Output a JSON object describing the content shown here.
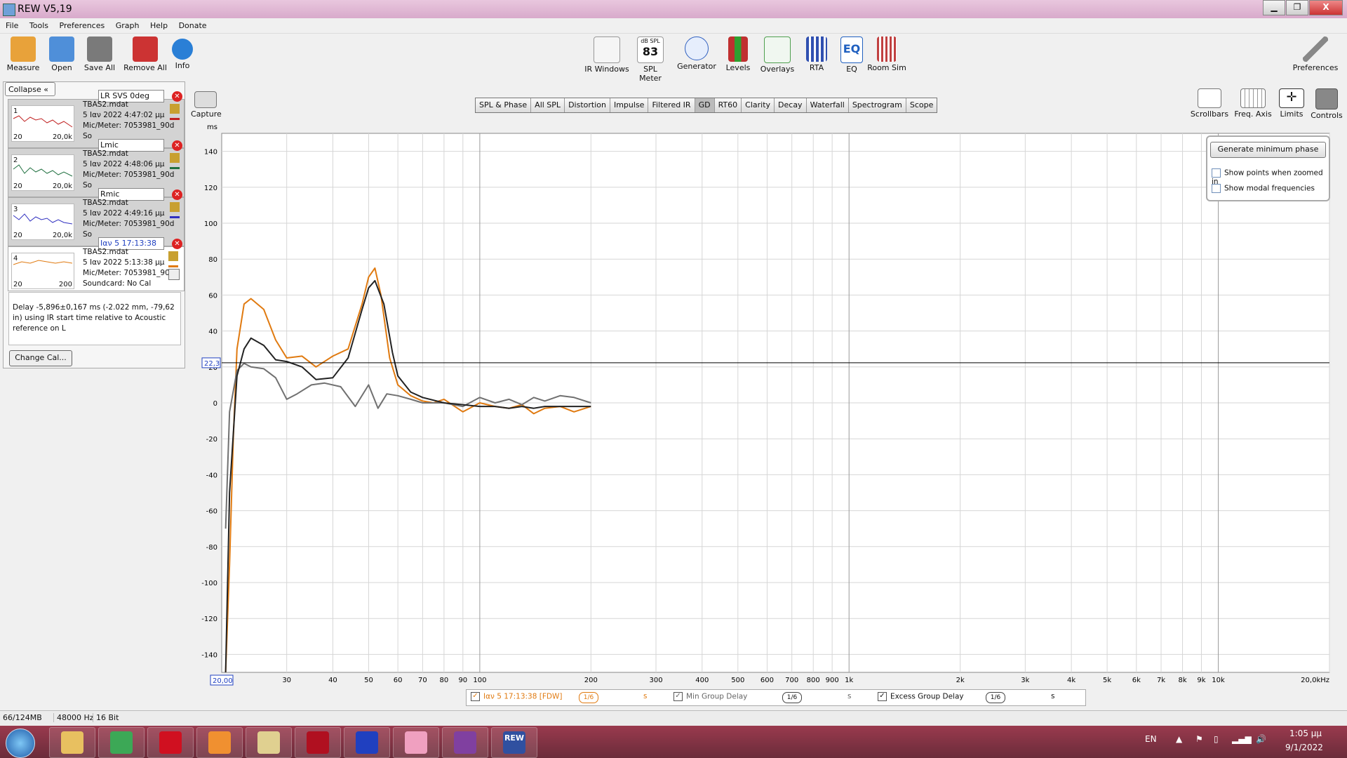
{
  "window": {
    "title": "REW V5,19",
    "min": "▁",
    "max": "❐",
    "close": "X"
  },
  "menu": [
    "File",
    "Tools",
    "Preferences",
    "Graph",
    "Help",
    "Donate"
  ],
  "toolbar_left": [
    {
      "label": "Measure",
      "icon": "measure-icon",
      "color": "#e8a23a"
    },
    {
      "label": "Open",
      "icon": "folder-icon",
      "color": "#4f8fd9"
    },
    {
      "label": "Save All",
      "icon": "save-icon",
      "color": "#7a7a7a"
    },
    {
      "label": "Remove All",
      "icon": "remove-icon",
      "color": "#cc3333"
    },
    {
      "label": "Info",
      "icon": "info-icon",
      "color": "#2a7fd6"
    }
  ],
  "toolbar_center": [
    {
      "label": "IR Windows",
      "icon": "ir-windows-icon",
      "color": "#c0506a"
    },
    {
      "label": "SPL Meter",
      "icon": "spl-meter-icon",
      "color": "#333333",
      "badge_top": "dB SPL",
      "badge_value": "83"
    },
    {
      "label": "Generator",
      "icon": "generator-icon",
      "color": "#3060c0"
    },
    {
      "label": "Levels",
      "icon": "levels-icon",
      "color": "#c03030"
    },
    {
      "label": "Overlays",
      "icon": "overlays-icon",
      "color": "#50a050"
    },
    {
      "label": "RTA",
      "icon": "rta-icon",
      "color": "#3050b0"
    },
    {
      "label": "EQ",
      "icon": "eq-icon",
      "color": "#2060c0",
      "badge_value": "EQ"
    },
    {
      "label": "Room Sim",
      "icon": "room-sim-icon",
      "color": "#c04040"
    }
  ],
  "toolbar_right": [
    {
      "label": "Preferences",
      "icon": "wrench-icon"
    }
  ],
  "graph_tools": [
    {
      "label": "Scrollbars",
      "icon": "scrollbars-icon"
    },
    {
      "label": "Freq. Axis",
      "icon": "freq-axis-icon"
    },
    {
      "label": "Limits",
      "icon": "limits-icon"
    },
    {
      "label": "Controls",
      "icon": "controls-icon"
    }
  ],
  "capture": {
    "label": "Capture",
    "icon": "camera-icon"
  },
  "collapse_label": "Collapse",
  "measurements": [
    {
      "num": "1",
      "name": "LR SVS 0deg",
      "file": "TBAS2.mdat",
      "date": "5 Ιαν 2022 4:47:02 μμ",
      "mic": "Mic/Meter: 7053981_90d",
      "sc": "So",
      "lo": "20",
      "hi": "20,0k",
      "color": "#c02020"
    },
    {
      "num": "2",
      "name": "Lmic",
      "file": "TBAS2.mdat",
      "date": "5 Ιαν 2022 4:48:06 μμ",
      "mic": "Mic/Meter: 7053981_90d",
      "sc": "So",
      "lo": "20",
      "hi": "20,0k",
      "color": "#207040"
    },
    {
      "num": "3",
      "name": "Rmic",
      "file": "TBAS2.mdat",
      "date": "5 Ιαν 2022 4:49:16 μμ",
      "mic": "Mic/Meter: 7053981_90d",
      "sc": "So",
      "lo": "20",
      "hi": "20,0k",
      "color": "#3030c0"
    },
    {
      "num": "4",
      "name": "Ιαν 5 17:13:38",
      "file": "TBAS2.mdat",
      "date": "5 Ιαν 2022 5:13:38 μμ",
      "mic": "Mic/Meter: 7053981_90d",
      "sc": "Soundcard: No Cal",
      "lo": "20",
      "hi": "200",
      "color": "#e07a10"
    }
  ],
  "delay_text": "Delay -5,896±0,167 ms (-2.022 mm, -79,62 in) using IR start time relative to Acoustic reference on  L",
  "change_cal": "Change Cal...",
  "tabs": [
    "SPL & Phase",
    "All SPL",
    "Distortion",
    "Impulse",
    "Filtered IR",
    "GD",
    "RT60",
    "Clarity",
    "Decay",
    "Waterfall",
    "Spectrogram",
    "Scope"
  ],
  "active_tab": "GD",
  "controls_panel": {
    "generate_button": "Generate minimum phase",
    "show_points": "Show points when zoomed in",
    "show_modal": "Show modal frequencies"
  },
  "legend": [
    {
      "label": "Ιαν 5 17:13:38 [FDW]",
      "smoothing": "1/6",
      "unit": "s",
      "color": "#e07a10"
    },
    {
      "label": "Min Group Delay",
      "smoothing": "1/6",
      "unit": "s",
      "color": "#666666"
    },
    {
      "label": "Excess Group Delay",
      "smoothing": "1/6",
      "unit": "s",
      "color": "#000000"
    }
  ],
  "statusbar": {
    "memory": "66/124MB",
    "rate": "48000 Hz",
    "bits": "16 Bit"
  },
  "taskbar": {
    "lang": "EN",
    "time": "1:05 μμ",
    "date": "9/1/2022",
    "apps": [
      {
        "icon": "explorer-icon",
        "color": "#e8c060"
      },
      {
        "icon": "chrome-icon",
        "color": "#3ca856"
      },
      {
        "icon": "opera-icon",
        "color": "#d01020"
      },
      {
        "icon": "firefox-icon",
        "color": "#f09030"
      },
      {
        "icon": "notepad-icon",
        "color": "#e0d090"
      },
      {
        "icon": "app-red-icon",
        "color": "#b01020"
      },
      {
        "icon": "audacity-icon",
        "color": "#2040c0"
      },
      {
        "icon": "paint-icon",
        "color": "#f0a0c0"
      },
      {
        "icon": "winrar-icon",
        "color": "#8040a0"
      },
      {
        "icon": "rew-icon",
        "color": "#3050a0",
        "label": "REW"
      }
    ]
  },
  "chart_data": {
    "type": "line",
    "ylabel": "ms",
    "xscale": "log",
    "xlim": [
      20,
      20000
    ],
    "ylim": [
      -150,
      150
    ],
    "marker_value": "22,3",
    "marker_y": 22.3,
    "xstart_label": "20,00",
    "yticks": [
      140,
      120,
      100,
      80,
      60,
      40,
      20,
      0,
      -20,
      -40,
      -60,
      -80,
      -100,
      -120,
      -140
    ],
    "xtick_labels": [
      {
        "v": 30,
        "t": "30"
      },
      {
        "v": 40,
        "t": "40"
      },
      {
        "v": 50,
        "t": "50"
      },
      {
        "v": 60,
        "t": "60"
      },
      {
        "v": 70,
        "t": "70"
      },
      {
        "v": 80,
        "t": "80"
      },
      {
        "v": 90,
        "t": "90"
      },
      {
        "v": 100,
        "t": "100"
      },
      {
        "v": 200,
        "t": "200"
      },
      {
        "v": 300,
        "t": "300"
      },
      {
        "v": 400,
        "t": "400"
      },
      {
        "v": 500,
        "t": "500"
      },
      {
        "v": 600,
        "t": "600"
      },
      {
        "v": 700,
        "t": "700"
      },
      {
        "v": 800,
        "t": "800"
      },
      {
        "v": 900,
        "t": "900"
      },
      {
        "v": 1000,
        "t": "1k"
      },
      {
        "v": 2000,
        "t": "2k"
      },
      {
        "v": 3000,
        "t": "3k"
      },
      {
        "v": 4000,
        "t": "4k"
      },
      {
        "v": 5000,
        "t": "5k"
      },
      {
        "v": 6000,
        "t": "6k"
      },
      {
        "v": 7000,
        "t": "7k"
      },
      {
        "v": 8000,
        "t": "8k"
      },
      {
        "v": 9000,
        "t": "9k"
      },
      {
        "v": 10000,
        "t": "10k"
      },
      {
        "v": 20000,
        "t": "20,0kHz"
      }
    ],
    "series": [
      {
        "name": "Ιαν 5 17:13:38 [FDW]",
        "color": "#e07a10",
        "x": [
          20.5,
          21,
          21.5,
          22,
          23,
          24,
          26,
          28,
          30,
          33,
          36,
          40,
          44,
          48,
          50,
          52,
          54,
          57,
          60,
          65,
          70,
          75,
          80,
          90,
          100,
          110,
          120,
          130,
          140,
          150,
          165,
          180,
          200
        ],
        "y": [
          -150,
          -90,
          -20,
          30,
          55,
          58,
          52,
          35,
          25,
          26,
          20,
          26,
          30,
          55,
          70,
          75,
          60,
          25,
          10,
          4,
          1,
          0,
          2,
          -5,
          0,
          -2,
          -3,
          -1,
          -6,
          -3,
          -2,
          -5,
          -2
        ]
      },
      {
        "name": "Min Group Delay",
        "color": "#707070",
        "x": [
          20.5,
          21,
          22,
          23,
          24,
          26,
          28,
          30,
          32,
          35,
          38,
          42,
          46,
          50,
          53,
          56,
          60,
          65,
          70,
          80,
          90,
          100,
          110,
          120,
          130,
          140,
          150,
          165,
          180,
          200
        ],
        "y": [
          -70,
          -5,
          18,
          22,
          20,
          19,
          14,
          2,
          5,
          10,
          11,
          9,
          -2,
          10,
          -3,
          5,
          4,
          2,
          0,
          0,
          -2,
          3,
          0,
          2,
          -1,
          3,
          1,
          4,
          3,
          0
        ]
      },
      {
        "name": "Excess Group Delay",
        "color": "#222222",
        "x": [
          20.5,
          21,
          22,
          23,
          24,
          26,
          28,
          30,
          33,
          36,
          40,
          44,
          48,
          50,
          52,
          55,
          58,
          60,
          65,
          70,
          80,
          90,
          100,
          110,
          120,
          130,
          140,
          150,
          165,
          180,
          200
        ],
        "y": [
          -150,
          -50,
          15,
          30,
          36,
          32,
          24,
          23,
          20,
          13,
          14,
          25,
          52,
          64,
          68,
          55,
          28,
          15,
          6,
          3,
          0,
          -1,
          -2,
          -2,
          -3,
          -2,
          -3,
          -2,
          -2,
          -2,
          -2
        ]
      }
    ]
  }
}
